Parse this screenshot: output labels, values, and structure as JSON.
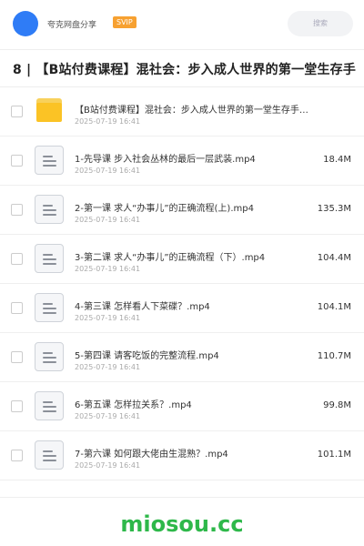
{
  "header": {
    "user_name": "夸克网盘分享",
    "badge": "SVIP",
    "search_placeholder": "搜索",
    "avatar_color": "#2f7cf6",
    "badge_color": "#f7a131"
  },
  "folder_title": "8 | 【B站付费课程】混社会：步入成人世界的第一堂生存手",
  "items": [
    {
      "type": "folder",
      "icon": "folder-icon",
      "name": "【B站付费课程】混社会：步入成人世界的第一堂生存手…",
      "date": "2025-07-19 16:41",
      "size": ""
    },
    {
      "type": "file",
      "icon": "document-icon",
      "name": "1-先导课 步入社会丛林的最后一层武装.mp4",
      "date": "2025-07-19 16:41",
      "size": "18.4M"
    },
    {
      "type": "file",
      "icon": "document-icon",
      "name": "2-第一课 求人“办事儿”的正确流程(上).mp4",
      "date": "2025-07-19 16:41",
      "size": "135.3M"
    },
    {
      "type": "file",
      "icon": "document-icon",
      "name": "3-第二课 求人“办事儿”的正确流程（下）.mp4",
      "date": "2025-07-19 16:41",
      "size": "104.4M"
    },
    {
      "type": "file",
      "icon": "document-icon",
      "name": "4-第三课 怎样看人下菜碟？.mp4",
      "date": "2025-07-19 16:41",
      "size": "104.1M"
    },
    {
      "type": "file",
      "icon": "document-icon",
      "name": "5-第四课 请客吃饭的完整流程.mp4",
      "date": "2025-07-19 16:41",
      "size": "110.7M"
    },
    {
      "type": "file",
      "icon": "document-icon",
      "name": "6-第五课 怎样拉关系？.mp4",
      "date": "2025-07-19 16:41",
      "size": "99.8M"
    },
    {
      "type": "file",
      "icon": "document-icon",
      "name": "7-第六课 如何跟大佬由生混熟？.mp4",
      "date": "2025-07-19 16:41",
      "size": "101.1M"
    }
  ],
  "watermark": "miosou.cc",
  "watermark_color": "#2eb84a"
}
